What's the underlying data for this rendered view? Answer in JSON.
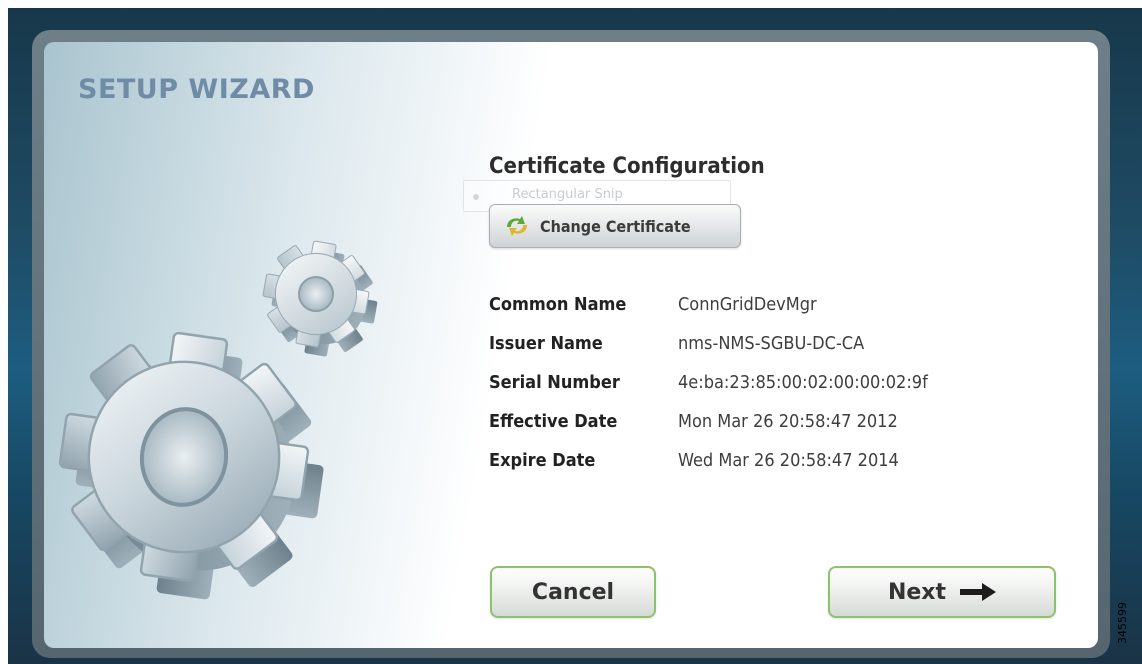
{
  "wizard": {
    "title": "SETUP WIZARD"
  },
  "section": {
    "title": "Certificate Configuration"
  },
  "snip_overlay": {
    "label": "Rectangular Snip"
  },
  "change_certificate": {
    "label": "Change Certificate"
  },
  "certificate": {
    "fields": [
      {
        "label": "Common Name",
        "value": "ConnGridDevMgr"
      },
      {
        "label": "Issuer Name",
        "value": "nms-NMS-SGBU-DC-CA"
      },
      {
        "label": "Serial Number",
        "value": "4e:ba:23:85:00:02:00:00:02:9f"
      },
      {
        "label": "Effective Date",
        "value": "Mon Mar 26 20:58:47 2012"
      },
      {
        "label": "Expire Date",
        "value": "Wed Mar 26 20:58:47 2014"
      }
    ]
  },
  "actions": {
    "cancel_label": "Cancel",
    "next_label": "Next"
  },
  "figure_id": "345599",
  "icons": {
    "change_certificate": "refresh-certificate-icon",
    "next": "right-arrow-icon",
    "illustration": "gears-icon"
  },
  "colors": {
    "title": "#6f8ba6",
    "button_border": "#8cc36a"
  }
}
